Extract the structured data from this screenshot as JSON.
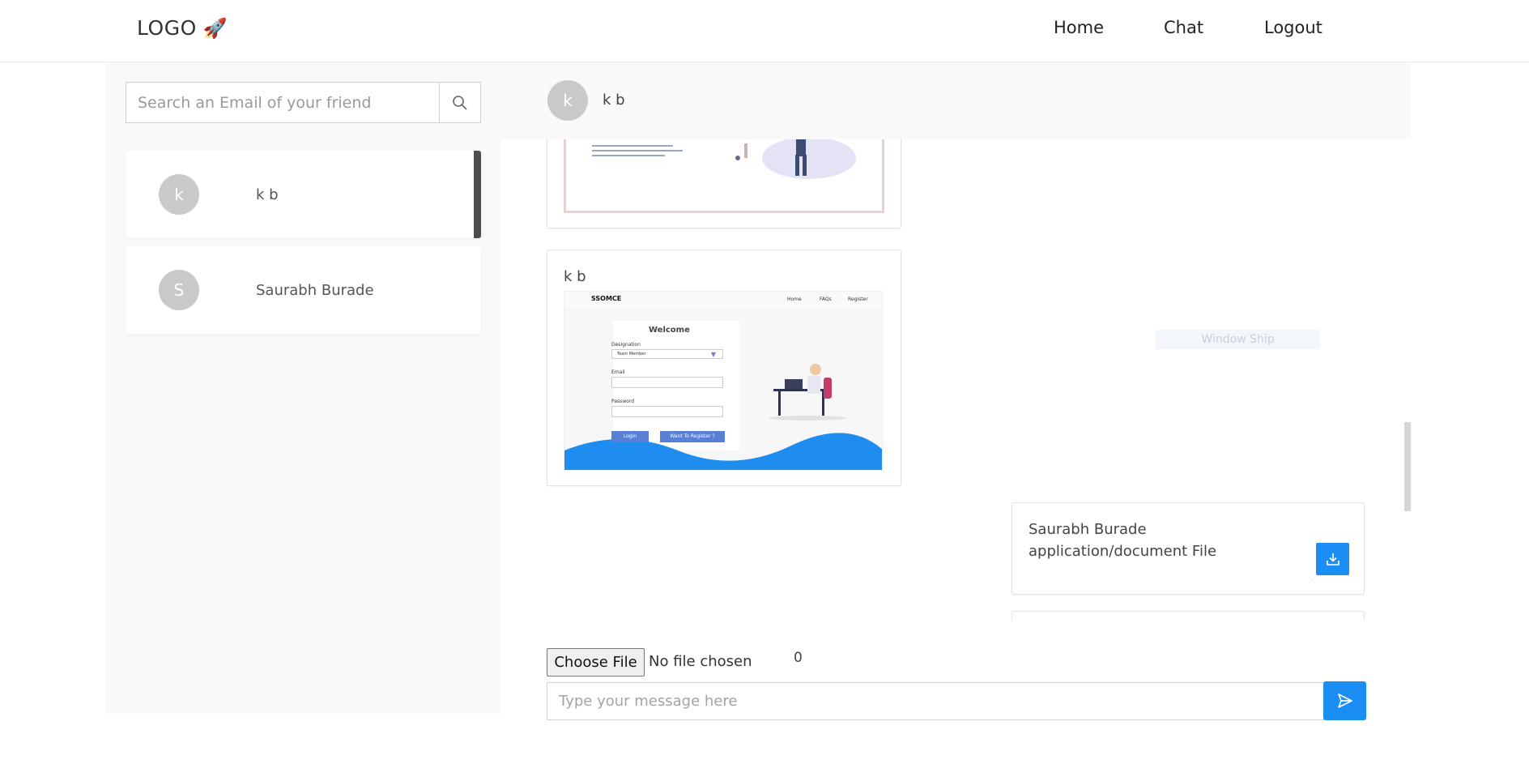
{
  "brand": {
    "logo_text": "LOGO",
    "logo_emoji": "🚀"
  },
  "nav": {
    "home": "Home",
    "chat": "Chat",
    "logout": "Logout"
  },
  "search": {
    "placeholder": "Search an Email of your friend"
  },
  "contacts": [
    {
      "initial": "k",
      "name": "k b",
      "active": true
    },
    {
      "initial": "S",
      "name": "Saurabh Burade",
      "active": false
    }
  ],
  "chat_header": {
    "initial": "k",
    "name": "k b"
  },
  "messages": [
    {
      "sender": "",
      "kind": "image",
      "preview": "illustration"
    },
    {
      "sender": "k b",
      "kind": "image",
      "preview": {
        "brand": "SSOMCE",
        "nav": [
          "Home",
          "FAQs",
          "Register"
        ],
        "heading": "Welcome",
        "designation_label": "Designation",
        "designation_value": "Team Member",
        "email_label": "Email",
        "password_label": "Password",
        "login": "Login",
        "register": "Want To Register ?"
      }
    },
    {
      "sender": "Saurabh Burade",
      "kind": "file",
      "file_type": "application/document File"
    }
  ],
  "watermark": "Window Ship",
  "composer": {
    "file_button": "Choose File",
    "file_status": "No file chosen",
    "counter": "0",
    "placeholder": "Type your message here"
  },
  "icons": {
    "search": "search-icon",
    "download": "download-icon",
    "send": "send-icon",
    "rocket": "rocket-icon"
  },
  "colors": {
    "accent": "#1a8ef5",
    "avatar": "#c9c9c9",
    "active_bar": "#4d4d4d",
    "wave": "#1f8df0"
  }
}
